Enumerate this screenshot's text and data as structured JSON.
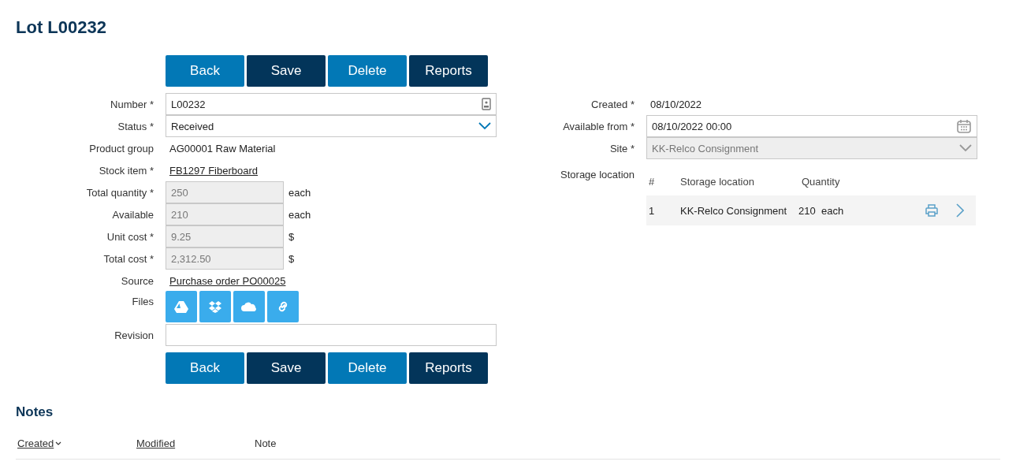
{
  "title": "Lot L00232",
  "top_buttons": [
    {
      "label": "Back",
      "kind": "light"
    },
    {
      "label": "Save",
      "kind": "dark"
    },
    {
      "label": "Delete",
      "kind": "light"
    },
    {
      "label": "Reports",
      "kind": "dark"
    }
  ],
  "bottom_buttons": [
    {
      "label": "Back",
      "kind": "light"
    },
    {
      "label": "Save",
      "kind": "dark"
    },
    {
      "label": "Delete",
      "kind": "light"
    },
    {
      "label": "Reports",
      "kind": "dark"
    }
  ],
  "fields": [
    {
      "kind": "number-input",
      "label": "Number *",
      "value": "L00232"
    },
    {
      "kind": "select",
      "label": "Status *",
      "value": "Received",
      "disabled": false
    },
    {
      "kind": "text",
      "label": "Product group",
      "value": "AG00001 Raw Material"
    },
    {
      "kind": "link",
      "label": "Stock item *",
      "value": "FB1297 Fiberboard"
    },
    {
      "kind": "unit",
      "label": "Total quantity *",
      "value": "250",
      "unit": "each"
    },
    {
      "kind": "unit",
      "label": "Available",
      "value": "210",
      "unit": "each"
    },
    {
      "kind": "unit",
      "label": "Unit cost *",
      "value": "9.25",
      "unit": "$"
    },
    {
      "kind": "unit",
      "label": "Total cost *",
      "value": "2,312.50",
      "unit": "$"
    },
    {
      "kind": "link",
      "label": "Source",
      "value": "Purchase order PO00025"
    },
    {
      "kind": "files",
      "label": "Files"
    },
    {
      "kind": "input",
      "label": "Revision"
    }
  ],
  "right_fields": [
    {
      "kind": "text",
      "label": "Created *",
      "value": "08/10/2022"
    },
    {
      "kind": "date-input",
      "label": "Available from *",
      "value": "08/10/2022 00:00"
    },
    {
      "kind": "select",
      "label": "Site *",
      "value": "KK-Relco Consignment",
      "disabled": true
    }
  ],
  "storage": {
    "label": "Storage location",
    "columns": [
      "#",
      "Storage location",
      "Quantity"
    ],
    "rows": [
      {
        "index": "1",
        "location": "KK-Relco Consignment",
        "quantity": "210",
        "unit": "each"
      }
    ]
  },
  "notes": {
    "title": "Notes",
    "columns": [
      {
        "label": "Created",
        "link": true,
        "sorted": true
      },
      {
        "label": "Modified",
        "link": true,
        "sorted": false
      },
      {
        "label": "Note",
        "link": false,
        "sorted": false
      }
    ]
  }
}
